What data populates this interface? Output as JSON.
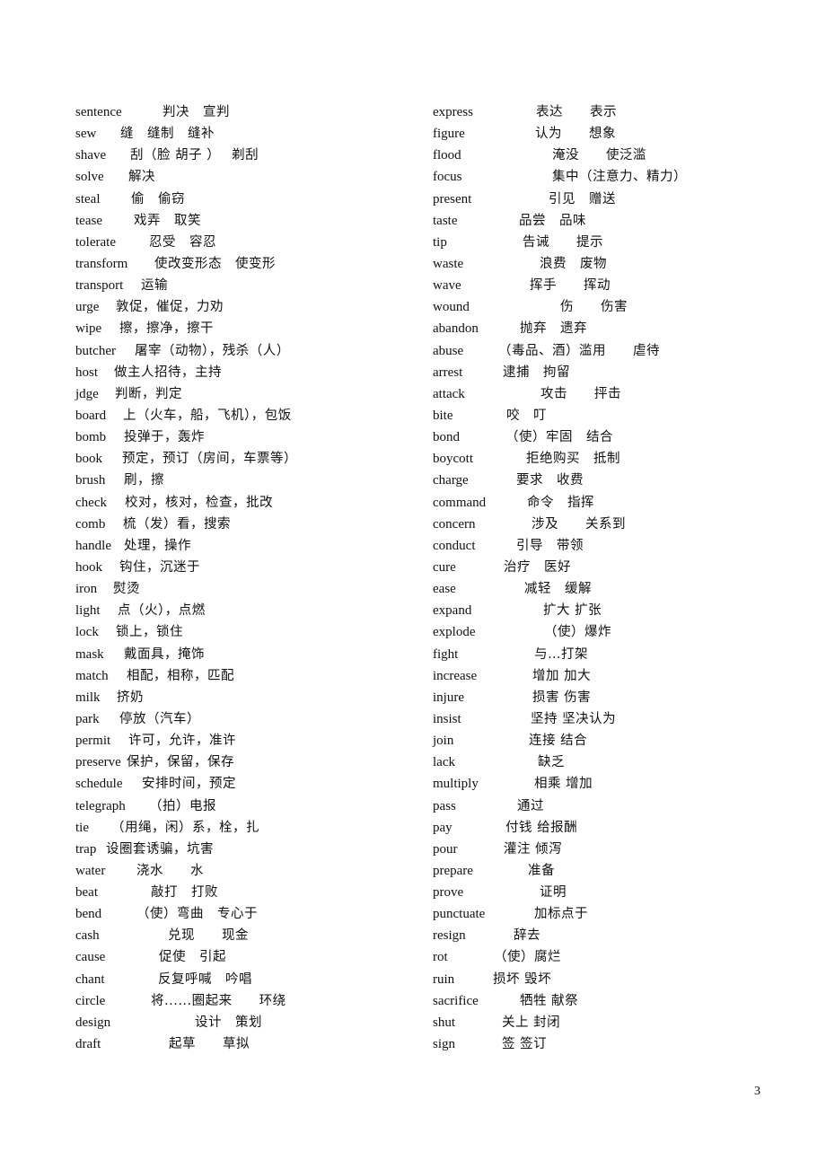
{
  "document": {
    "page_number": "3",
    "left_column": [
      {
        "word": "sentence",
        "definition": "判决　宣判"
      },
      {
        "word": "sew",
        "definition": "缝　缝制　缝补"
      },
      {
        "word": "shave",
        "definition": "刮（脸 胡子 ）　 剃刮"
      },
      {
        "word": "solve",
        "definition": "解决"
      },
      {
        "word": "steal",
        "definition": "偷　偷窃"
      },
      {
        "word": "tease",
        "definition": "戏弄　取笑"
      },
      {
        "word": "tolerate",
        "definition": "忍受　容忍"
      },
      {
        "word": "transform",
        "definition": "使改变形态　使变形"
      },
      {
        "word": "transport",
        "definition": "运输"
      },
      {
        "word": "urge",
        "definition": "敦促，催促，力劝"
      },
      {
        "word": "wipe",
        "definition": "擦，擦净，擦干"
      },
      {
        "word": "butcher",
        "definition": "屠宰（动物），残杀（人）"
      },
      {
        "word": "host",
        "definition": "做主人招待，主持"
      },
      {
        "word": "jdge",
        "definition": "判断，判定"
      },
      {
        "word": "board",
        "definition": "上（火车，船，飞机），包饭"
      },
      {
        "word": "bomb",
        "definition": "投弹于，轰炸"
      },
      {
        "word": "book",
        "definition": "预定，预订（房间，车票等）"
      },
      {
        "word": "brush",
        "definition": "刷，擦"
      },
      {
        "word": "check",
        "definition": "校对，核对，检查，批改"
      },
      {
        "word": "comb",
        "definition": "梳（发）看，搜索"
      },
      {
        "word": "handle",
        "definition": "处理，操作"
      },
      {
        "word": "hook",
        "definition": "钩住，沉迷于"
      },
      {
        "word": "iron",
        "definition": "熨烫"
      },
      {
        "word": "light",
        "definition": "点（火），点燃"
      },
      {
        "word": "lock",
        "definition": "锁上，锁住"
      },
      {
        "word": "mask",
        "definition": "戴面具，掩饰"
      },
      {
        "word": "match",
        "definition": "相配，相称，匹配"
      },
      {
        "word": "milk",
        "definition": "挤奶"
      },
      {
        "word": "park",
        "definition": "停放（汽车）"
      },
      {
        "word": "permit",
        "definition": "许可，允许，准许"
      },
      {
        "word": "preserve",
        "definition": "保护，保留，保存"
      },
      {
        "word": "schedule",
        "definition": "安排时间，预定"
      },
      {
        "word": "telegraph",
        "definition": "（拍）电报"
      },
      {
        "word": "tie",
        "definition": "（用绳，闲）系，栓，扎"
      },
      {
        "word": "trap",
        "definition": "设圈套诱骗，坑害"
      },
      {
        "word": "water",
        "definition": "浇水　　水"
      },
      {
        "word": "beat",
        "definition": "敲打　打败"
      },
      {
        "word": "bend",
        "definition": "（使）弯曲　专心于"
      },
      {
        "word": "cash",
        "definition": "兑现　　现金"
      },
      {
        "word": "cause",
        "definition": "促使　引起"
      },
      {
        "word": "chant",
        "definition": "反复呼喊　吟唱"
      },
      {
        "word": "circle",
        "definition": "将......圈起来　　环绕"
      },
      {
        "word": "design",
        "definition": "设计　策划"
      },
      {
        "word": "draft",
        "definition": "起草　　草拟"
      }
    ],
    "right_column": [
      {
        "word": "express",
        "definition": "表达　　表示"
      },
      {
        "word": "figure",
        "definition": "认为　　想象"
      },
      {
        "word": "flood",
        "definition": "淹没　　使泛滥"
      },
      {
        "word": "focus",
        "definition": "集中（注意力、精力）"
      },
      {
        "word": "present",
        "definition": "引见　赠送"
      },
      {
        "word": "taste",
        "definition": "品尝　品味"
      },
      {
        "word": "tip",
        "definition": "告诫　　提示"
      },
      {
        "word": "waste",
        "definition": "浪费　废物"
      },
      {
        "word": "wave",
        "definition": "挥手　　挥动"
      },
      {
        "word": "wound",
        "definition": "伤　　伤害"
      },
      {
        "word": "abandon",
        "definition": "抛弃　遗弃"
      },
      {
        "word": "abuse",
        "definition": "（毒品、酒）滥用　　虐待"
      },
      {
        "word": "arrest",
        "definition": "逮捕　拘留"
      },
      {
        "word": "attack",
        "definition": "攻击　　抨击"
      },
      {
        "word": "bite",
        "definition": "咬　叮"
      },
      {
        "word": "bond",
        "definition": "（使）牢固　结合"
      },
      {
        "word": "boycott",
        "definition": "拒绝购买　抵制"
      },
      {
        "word": "charge",
        "definition": "要求　收费"
      },
      {
        "word": "command",
        "definition": "命令　指挥"
      },
      {
        "word": "concern",
        "definition": "涉及　　关系到"
      },
      {
        "word": "conduct",
        "definition": "引导　带领"
      },
      {
        "word": "cure",
        "definition": "治疗　医好"
      },
      {
        "word": "ease",
        "definition": "减轻　缓解"
      },
      {
        "word": "expand",
        "definition": "扩大 扩张"
      },
      {
        "word": "explode",
        "definition": "（使）爆炸"
      },
      {
        "word": "fight",
        "definition": "与…打架"
      },
      {
        "word": "increase",
        "definition": "增加 加大"
      },
      {
        "word": "injure",
        "definition": "损害 伤害"
      },
      {
        "word": "insist",
        "definition": "坚持 坚决认为"
      },
      {
        "word": "join",
        "definition": "连接 结合"
      },
      {
        "word": "lack",
        "definition": "缺乏"
      },
      {
        "word": "multiply",
        "definition": "相乘 增加"
      },
      {
        "word": "pass",
        "definition": "通过"
      },
      {
        "word": "pay",
        "definition": "付钱 给报酬"
      },
      {
        "word": "pour",
        "definition": "灌注 倾泻"
      },
      {
        "word": "prepare",
        "definition": "准备"
      },
      {
        "word": "prove",
        "definition": "证明"
      },
      {
        "word": "punctuate",
        "definition": "加标点于"
      },
      {
        "word": "resign",
        "definition": "辞去"
      },
      {
        "word": "rot",
        "definition": "（使）腐烂"
      },
      {
        "word": "ruin",
        "definition": "损坏 毁坏"
      },
      {
        "word": "sacrifice",
        "definition": "牺牲 献祭"
      },
      {
        "word": "shut",
        "definition": "关上 封闭"
      },
      {
        "word": "sign",
        "definition": "签 签订"
      }
    ]
  }
}
